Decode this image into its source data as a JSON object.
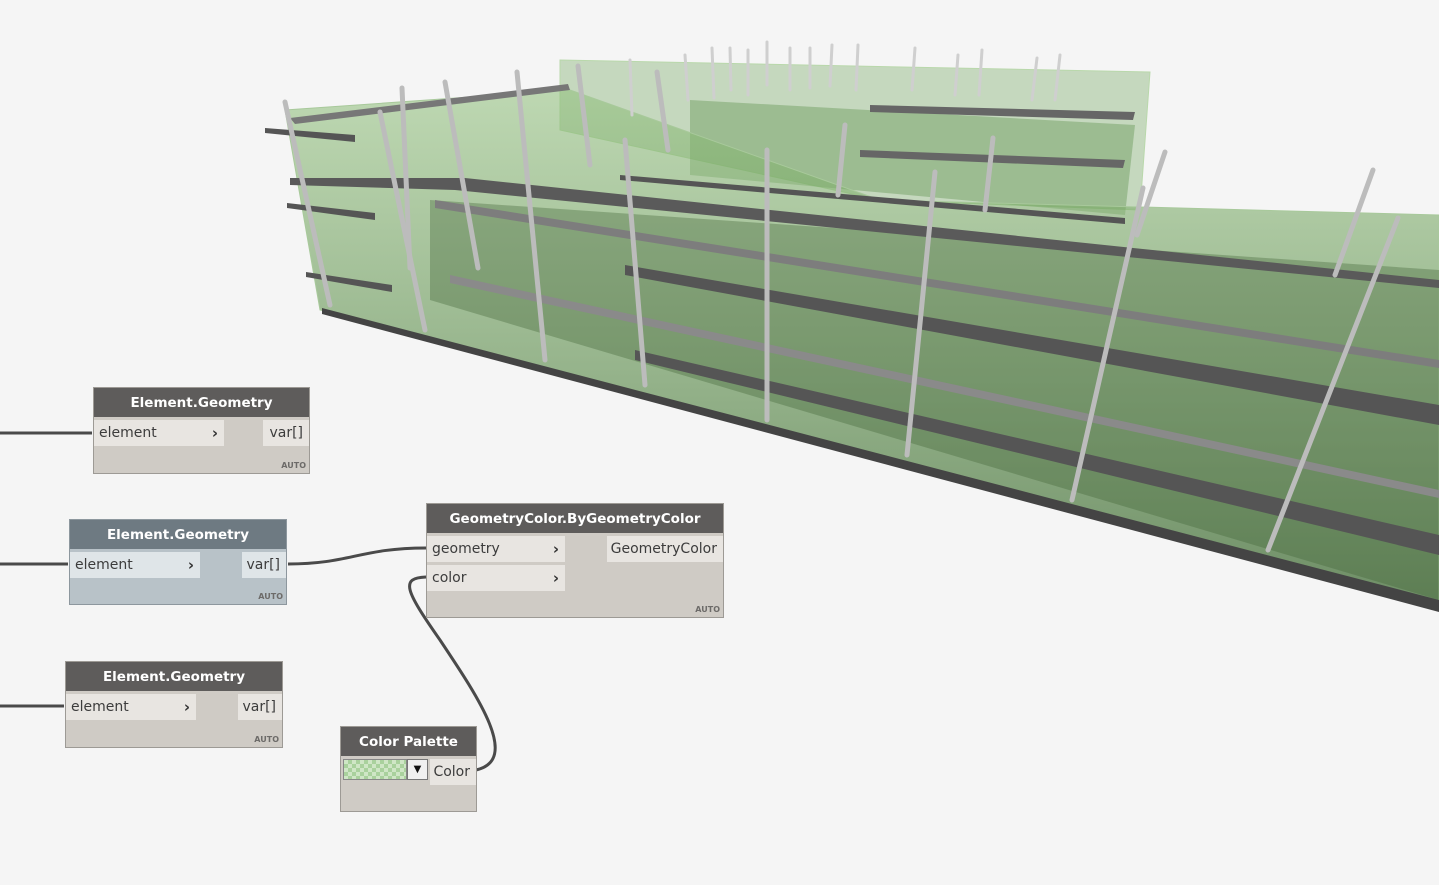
{
  "canvas": {
    "background_color": "#f5f5f5",
    "model_color": "#5f8f4f",
    "wire_color": "#4a4a4a"
  },
  "nodes": {
    "element_geometry_1": {
      "title": "Element.Geometry",
      "input": "element",
      "output": "var[]",
      "lacing": "AUTO"
    },
    "element_geometry_2": {
      "title": "Element.Geometry",
      "input": "element",
      "output": "var[]",
      "lacing": "AUTO"
    },
    "element_geometry_3": {
      "title": "Element.Geometry",
      "input": "element",
      "output": "var[]",
      "lacing": "AUTO"
    },
    "geometry_color": {
      "title": "GeometryColor.ByGeometryColor",
      "input_1": "geometry",
      "input_2": "color",
      "output": "GeometryColor",
      "lacing": "AUTO"
    },
    "color_palette": {
      "title": "Color Palette",
      "output": "Color",
      "swatch_color": "#cfe6c6",
      "dropdown_icon": "chevron-down-icon"
    }
  }
}
